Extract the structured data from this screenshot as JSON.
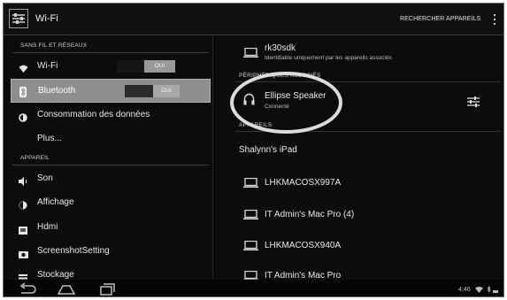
{
  "topbar": {
    "title": "Wi-Fi",
    "scan_label": "RECHERCHER APPAREILS"
  },
  "left": {
    "section_wireless": "SANS FIL ET RÉSEAUX",
    "wifi_label": "Wi-Fi",
    "wifi_toggle": "OUI",
    "bluetooth_label": "Bluetooth",
    "bluetooth_toggle": "OUI",
    "data_usage_label": "Consommation des données",
    "more_label": "Plus...",
    "section_device": "APPAREIL",
    "sound_label": "Son",
    "display_label": "Affichage",
    "hdmi_label": "Hdmi",
    "screenshot_label": "ScreenshotSetting",
    "storage_label": "Stockage"
  },
  "right": {
    "own_device_name": "rk30sdk",
    "own_device_sub": "Identifiable uniquement par les appareils associés",
    "section_paired": "PÉRIPHÉRIQUES ASSOCIÉS",
    "paired_device_name": "Ellipse Speaker",
    "paired_device_status": "Connecté",
    "section_available": "APPAREILS",
    "available_devices": [
      "Shalynn's iPad",
      "LHKMACOSX997A",
      "IT Admin's Mac Pro (4)",
      "LHKMACOSX940A",
      "IT Admin's Mac Pro"
    ]
  },
  "statusbar": {
    "time": "4:46"
  },
  "colors": {
    "background": "#0c0c0c",
    "selected_row": "#8e8e8e",
    "toggle_off": "#9a9a9a"
  },
  "icons": {
    "app": "settings-sliders-icon",
    "wifi": "wifi-icon",
    "bluetooth": "bluetooth-icon",
    "data_usage": "data-usage-icon",
    "sound": "speaker-icon",
    "display": "brightness-icon",
    "hdmi": "hdmi-icon",
    "screenshot": "camera-icon",
    "storage": "storage-icon",
    "laptop": "laptop-icon",
    "headset": "headset-icon",
    "settings": "settings-sliders-icon",
    "back": "back-icon",
    "home": "home-icon",
    "recents": "recents-icon"
  }
}
